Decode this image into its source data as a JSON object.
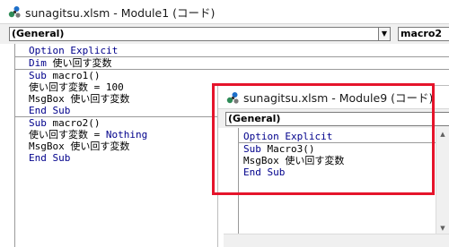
{
  "module1": {
    "title": "sunagitsu.xlsm - Module1 (コード)",
    "object_combo": "(General)",
    "proc_combo": "macro2",
    "code": {
      "l1_kw": "Option Explicit",
      "l2_kw": "Dim",
      "l2_rest": " 使い回す変数",
      "l3_kw": "Sub",
      "l3_rest": " macro1()",
      "l4": "使い回す変数 = 100",
      "l5": "MsgBox 使い回す変数",
      "l6_kw": "End Sub",
      "l7_kw": "Sub",
      "l7_rest": " macro2()",
      "l8_pre": "使い回す変数 = ",
      "l8_kw": "Nothing",
      "l9": "MsgBox 使い回す変数",
      "l10_kw": "End Sub"
    }
  },
  "module9": {
    "title": "sunagitsu.xlsm - Module9 (コード)",
    "object_combo": "(General)",
    "code": {
      "l1_kw": "Option Explicit",
      "l2_kw": "Sub",
      "l2_rest": " Macro3()",
      "l3": "MsgBox 使い回す変数",
      "l4_kw": "End Sub"
    }
  },
  "colors": {
    "highlight_frame": "#e5142b",
    "keyword": "#00008b"
  },
  "icons": {
    "app": "vba-module-icon",
    "dropdown": "chevron-down-icon"
  }
}
